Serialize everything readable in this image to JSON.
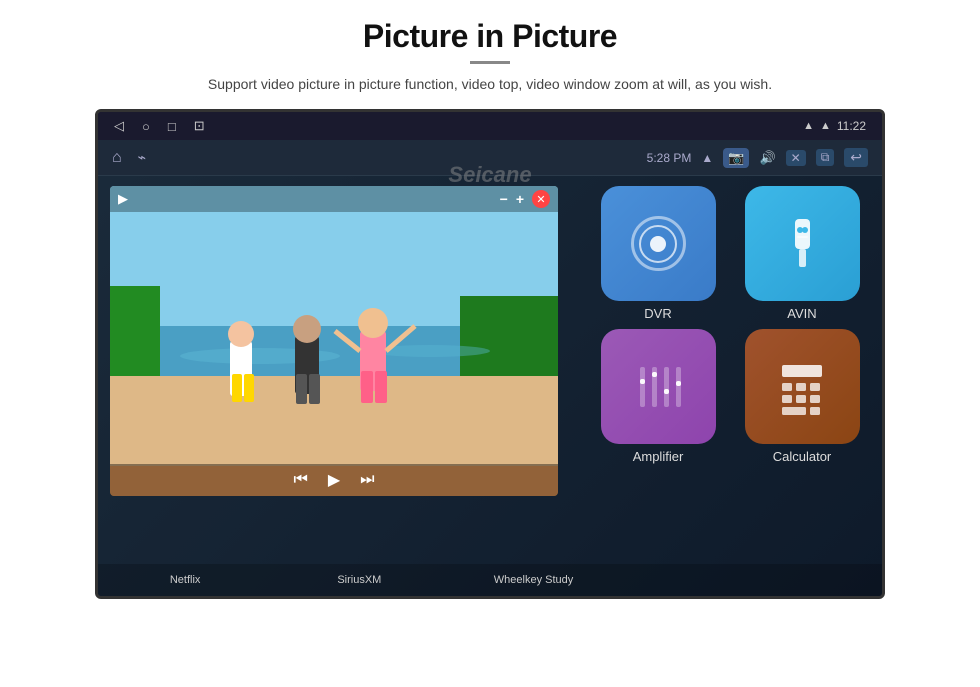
{
  "header": {
    "title": "Picture in Picture",
    "subtitle": "Support video picture in picture function, video top, video window zoom at will, as you wish.",
    "watermark": "Seicane"
  },
  "status_bar": {
    "nav_back": "◁",
    "nav_home": "○",
    "nav_recents": "□",
    "nav_extra": "⊡",
    "wifi": "▲",
    "signal": "▲",
    "time": "11:22"
  },
  "toolbar": {
    "home_icon": "⌂",
    "usb_icon": "⌁",
    "wifi_label": "5:28 PM",
    "camera_icon": "📷",
    "volume_icon": "🔊",
    "close_icon": "✕",
    "clone_icon": "⧉",
    "back_icon": "↩"
  },
  "pip_window": {
    "video_icon": "▶",
    "minimize_btn": "−",
    "expand_btn": "+",
    "close_btn": "✕",
    "prev_btn": "⏮",
    "play_btn": "▶",
    "next_btn": "⏭"
  },
  "apps": [
    {
      "id": "netflix",
      "label": "Netflix",
      "color": "#e50914",
      "icon": "N"
    },
    {
      "id": "siriusxm",
      "label": "SiriusXM",
      "color": "#cc2b2b",
      "icon": "S"
    },
    {
      "id": "wheelkey",
      "label": "Wheelkey Study",
      "color": "#7b2fbe",
      "icon": "W"
    },
    {
      "id": "dvr",
      "label": "DVR",
      "color": "#4a90d9",
      "icon_type": "dvr"
    },
    {
      "id": "avin",
      "label": "AVIN",
      "color": "#3db8e8",
      "icon_type": "avin"
    },
    {
      "id": "amplifier",
      "label": "Amplifier",
      "color": "#9b59b6",
      "icon_type": "amp"
    },
    {
      "id": "calculator",
      "label": "Calculator",
      "color": "#a0522d",
      "icon_type": "calc"
    }
  ],
  "labels": {
    "netflix": "Netflix",
    "siriusxm": "SiriusXM",
    "wheelkey": "Wheelkey Study",
    "dvr": "DVR",
    "avin": "AVIN",
    "amplifier": "Amplifier",
    "calculator": "Calculator"
  }
}
